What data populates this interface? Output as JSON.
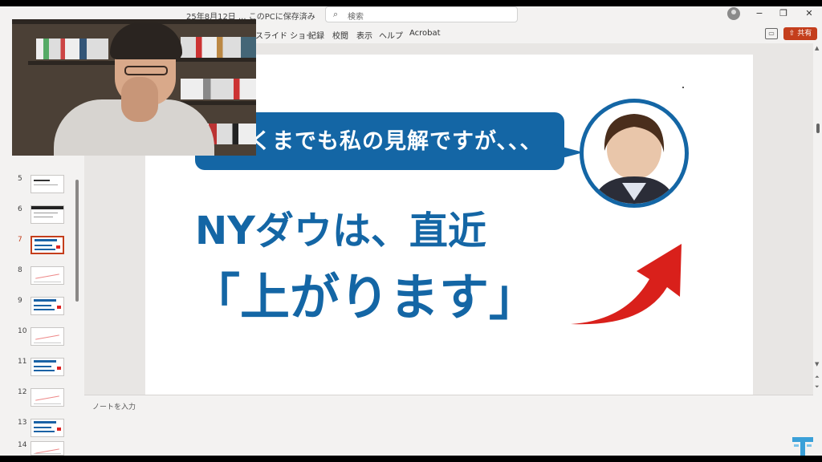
{
  "titlebar": {
    "title": "25年8月12日 ... このPCに保存済み",
    "search_icon": "search-icon",
    "search_placeholder": "検索",
    "min_label": "−",
    "max_label": "❐",
    "close_label": "✕"
  },
  "ribbon": {
    "tabs": [
      "スライド ショー",
      "記録",
      "校閲",
      "表示",
      "ヘルプ",
      "Acrobat"
    ],
    "share_label": "共有"
  },
  "thumbnails": {
    "numbers": [
      "5",
      "6",
      "7",
      "8",
      "9",
      "10",
      "11",
      "12",
      "13",
      "14"
    ],
    "active_index": 2
  },
  "slide": {
    "bubble_text": "くまでも私の見解ですが、、、",
    "headline": "NYダウは、直近",
    "big_text": "「上がります」",
    "primary_color": "#1466a5",
    "arrow_color": "#d9201b"
  },
  "notes": {
    "placeholder": "ノートを入力"
  }
}
